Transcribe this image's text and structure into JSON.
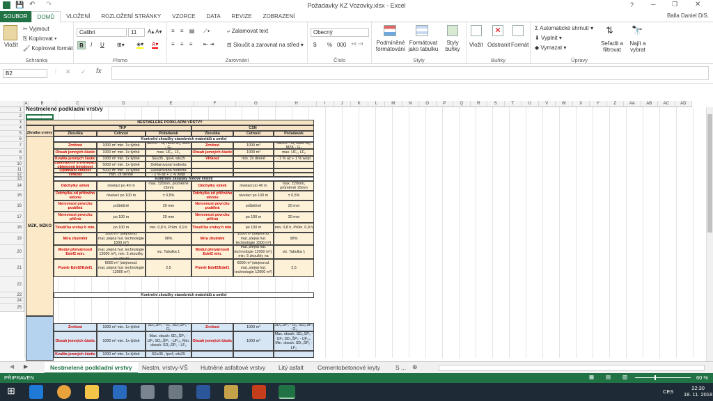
{
  "window": {
    "title": "Požadavky KZ Vozovky.xlsx - Excel",
    "user": "Balla Daniel DiS."
  },
  "ribbon_tabs": [
    "SOUBOR",
    "DOMŮ",
    "VLOŽENÍ",
    "ROZLOŽENÍ STRÁNKY",
    "VZORCE",
    "DATA",
    "REVIZE",
    "ZOBRAZENÍ"
  ],
  "clipboard": {
    "paste": "Vložit",
    "cut": "Vyjmout",
    "copy": "Kopírovat",
    "format_painter": "Kopírovat formát",
    "label": "Schránka"
  },
  "font": {
    "name": "Calibri",
    "size": "11",
    "label": "Písmo",
    "bold": "B",
    "italic": "I",
    "underline": "U"
  },
  "alignment": {
    "wrap": "Zalamovat text",
    "merge": "Sloučit a zarovnat na střed",
    "label": "Zarovnání"
  },
  "number": {
    "format": "Obecný",
    "label": "Číslo",
    "currency": "$",
    "percent": "%",
    "thousands": "000"
  },
  "styles": {
    "conditional": "Podmíněné formátování",
    "as_table": "Formátovat jako tabulku",
    "cell_styles": "Styly buňky",
    "label": "Styly"
  },
  "cells": {
    "insert": "Vložit",
    "delete": "Odstranit",
    "format": "Formát",
    "label": "Buňky"
  },
  "editing": {
    "autosum": "Automatické shrnutí",
    "fill": "Vyplnit",
    "clear": "Vymazat",
    "sort": "Seřadit a filtrovat",
    "find": "Najít a vybrat",
    "label": "Úpravy"
  },
  "formula_bar": {
    "name_box": "B2",
    "formula": ""
  },
  "columns": [
    "A",
    "B",
    "C",
    "D",
    "E",
    "F",
    "G",
    "H",
    "I",
    "J",
    "K",
    "L",
    "M",
    "N",
    "O",
    "P",
    "Q",
    "R",
    "S",
    "T",
    "U",
    "V",
    "W",
    "X",
    "Y",
    "Z",
    "AA",
    "AB",
    "AC",
    "AD"
  ],
  "rows": [
    "1",
    "2",
    "3",
    "4",
    "5",
    "6",
    "7",
    "8",
    "9",
    "10",
    "11",
    "12",
    "13",
    "14",
    "15",
    "16",
    "17",
    "18",
    "19",
    "20",
    "21",
    "22",
    "23",
    "24",
    "25"
  ],
  "sheet": {
    "title": "Nestmelené podkladní vrstvy",
    "header": "NESTMELENÉ PODKLADNÍ VRSTVY",
    "col_zkratka": "Zkratka vrstvy",
    "tkp": "TKP",
    "csn": "ČSN",
    "zkouska": "Zkouška",
    "cetnost": "Četnost",
    "pozadavek": "Požadavek",
    "sec1": "Kontrolní zkoušky stavebních materiálů a směsí",
    "sec2": "Kontrolní zkoušky hotové vrstvy",
    "layer": "MZK, MZKO",
    "r7": [
      "Zrnitost",
      "1000 m³ min. 1x týdně",
      "MZKO - G₁ nebo G₂, MZK - G₃",
      "Zrnitost",
      "1000 m³",
      "MZKO - G₁ nebo G₂, MZK - G₃"
    ],
    "r8": [
      "Obsah jemných částic",
      "1000 m³ min. 1x týdně",
      "max. UF₅, LF₂",
      "Obsah jemných částic",
      "1000 m³",
      "max. UF₅, LF₂"
    ],
    "r9": [
      "Kvalita jemných částic",
      "1000 m³ min. 1x týdně",
      "SE≥35 , Ip≤4, wl≤25",
      "Vlhkost",
      "min. 2x denně",
      "- 2 % až + 1 % wopt"
    ],
    "r10": [
      "Laboratorní srovnávací objemová hmotnost",
      "5000 m³ min. 1x týdně",
      "Deklarovaná hodnota"
    ],
    "r11": [
      "Optimální vlhkost",
      "5000 m³ min. 1x týdně",
      "Deklarovaná hodnota"
    ],
    "r12": [
      "Vlhkost",
      "min. 2x denně",
      "- 2 % až + 1 % wopt"
    ],
    "r14": [
      "Odchylky výšek",
      "nivelací po 40 m",
      "max. ±20mm, průměrně ±5mm",
      "Odchylky výšek",
      "nivelací po 40 m",
      "max. ±20mm, průměrně ±5mm"
    ],
    "r15": [
      "Odchylka od příčného sklonu",
      "nivelací po 100 m",
      "± 0,5%",
      "Odchylka od příčného sklonu",
      "nivelací po 100 m",
      "± 0,5%"
    ],
    "r16": [
      "Nerovnost povrchu podélná",
      "průběžně",
      "20 mm",
      "Nerovnost povrchu podélná",
      "průběžně",
      "20 mm"
    ],
    "r17": [
      "Nerovnost povrchu příčná",
      "po 100 m",
      "20 mm",
      "Nerovnost povrchu příčná",
      "po 100 m",
      "20 mm"
    ],
    "r18": [
      "Tloušťka vrstvy h min.",
      "po 100 m",
      "min. 0,8 h, Prům. 0,9 h",
      "Tloušťka vrstvy h min.",
      "po 100 m",
      "min. 0,8 h, Prům. 0,9 h"
    ],
    "r19": [
      "Míra zhutnění",
      "1000 m³ (stejnorod. mat.,stejná hut. technologie 1500 m³)",
      "98%",
      "Míra zhutnění",
      "1000 m³ (stejnorod. mat.,stejná hut. technologie 1500 m³)",
      "98%"
    ],
    "r20": [
      "Modul přetvárnosti Edef2 min.",
      "6000 m² (stejnorod. mat.,stejná hut. technologie 12000 m²), min. 5 zkoušky na objekt",
      "viz. Tabulka 1",
      "Modul přetvárnosti Edef2 min.",
      "6000 m² (stejnorod. mat.,stejná hut. technologie 12000 m²), min. 5 zkoušky na objekt",
      "viz. Tabulka 1"
    ],
    "r21": [
      "Poměr Edef2/Edef1",
      "6000 m² (stejnorod. mat.,stejná hut. technologie 12000 m²)",
      "2,5",
      "Poměr Edef2/Edef1",
      "6000 m² (stejnorod. mat.,stejná hut. technologie 12000 m²)",
      "2,5"
    ],
    "r23": [
      "Zrnitost",
      "1000 m³ min. 1x týdně",
      "SD₀,ŠP₀ - G₀, SD₀,ŠP₀ - G₀",
      "Zrnitost",
      "1000 m³",
      "SD₀,ŠP₀ - G₀, SD₀,ŠP₀ - G₀"
    ],
    "r24": [
      "Obsah jemných částic",
      "1000 m³ min. 1x týdně",
      "Max. obsah: SD₀,ŠP₀ - UF₅ SD₀,ŠP₀ - UF₁₀, Min. obsah: SD₀,ŠP₀ - LF₂",
      "Obsah jemných částic",
      "1000 m³",
      "Max. obsah: SD₀,ŠP₀ - UF₅ SD₀,ŠP₀ - UF₁₀, Min. obsah: SD₀,ŠP₀ - LF₂"
    ],
    "r25": [
      "Kvalita jemných částic",
      "1000 m³ min. 1x týdně",
      "SE≥35 , Ip≤4, wl≤25"
    ]
  },
  "sheet_tabs": [
    "Nestmelené podkladní vrstvy",
    "Nestm. vrstvy-VŠ",
    "Hutněné asfaltové vrstvy",
    "Litý asfalt",
    "Cementobetonové kryty",
    "S ..."
  ],
  "status": {
    "ready": "PŘIPRAVEN",
    "zoom": "60 %"
  },
  "taskbar": {
    "time": "22:30",
    "date": "18. 11. 2018",
    "lang": "CES"
  }
}
